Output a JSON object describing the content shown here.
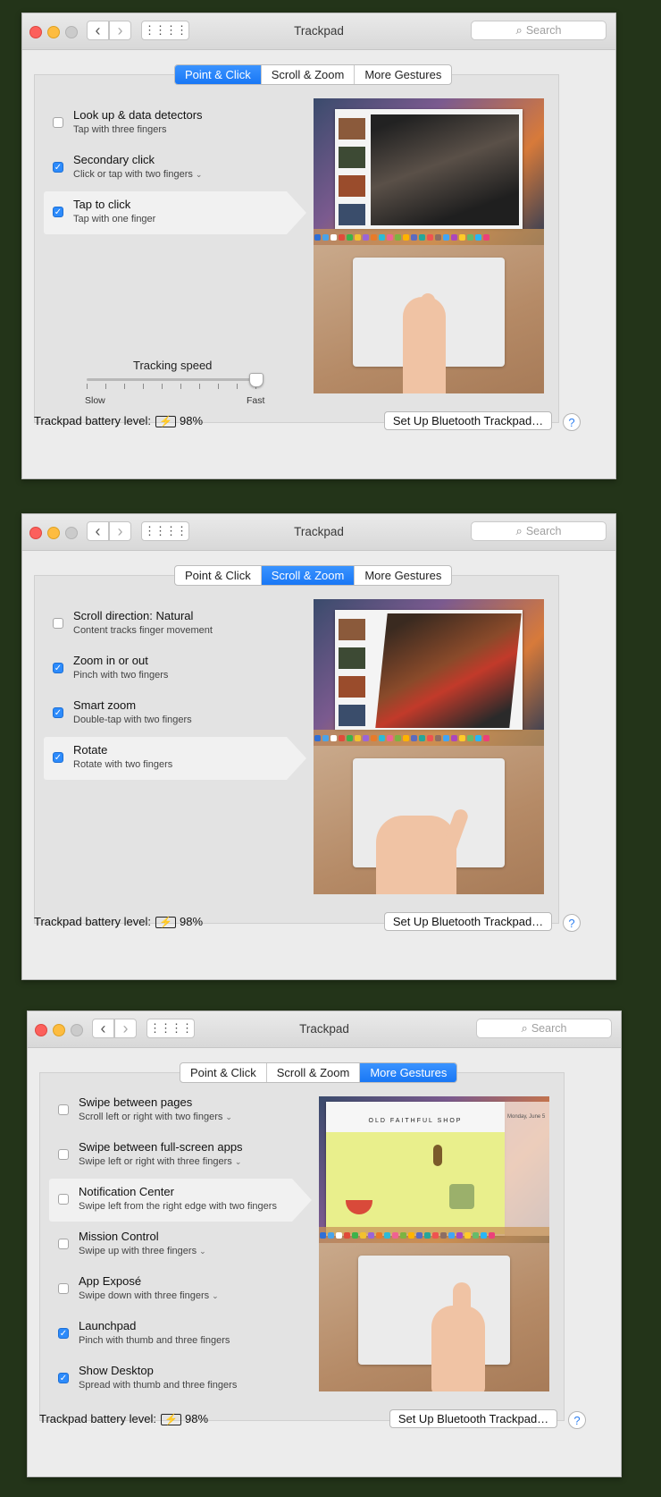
{
  "window_title": "Trackpad",
  "search_placeholder": "Search",
  "tabs": [
    "Point & Click",
    "Scroll & Zoom",
    "More Gestures"
  ],
  "footer": {
    "battery_label": "Trackpad battery level:",
    "battery_value": "98%",
    "setup_button": "Set Up Bluetooth Trackpad…",
    "help": "?"
  },
  "panels": [
    {
      "active_tab": "Point & Click",
      "options": [
        {
          "title": "Look up & data detectors",
          "subtitle": "Tap with three fingers",
          "checked": false,
          "selected": false,
          "has_menu": false
        },
        {
          "title": "Secondary click",
          "subtitle": "Click or tap with two fingers",
          "checked": true,
          "selected": false,
          "has_menu": true
        },
        {
          "title": "Tap to click",
          "subtitle": "Tap with one finger",
          "checked": true,
          "selected": true,
          "has_menu": false
        }
      ],
      "slider": {
        "label": "Tracking speed",
        "min_label": "Slow",
        "max_label": "Fast",
        "value_fraction": 0.97
      }
    },
    {
      "active_tab": "Scroll & Zoom",
      "options": [
        {
          "title": "Scroll direction: Natural",
          "subtitle": "Content tracks finger movement",
          "checked": false,
          "selected": false,
          "has_menu": false
        },
        {
          "title": "Zoom in or out",
          "subtitle": "Pinch with two fingers",
          "checked": true,
          "selected": false,
          "has_menu": false
        },
        {
          "title": "Smart zoom",
          "subtitle": "Double-tap with two fingers",
          "checked": true,
          "selected": false,
          "has_menu": false
        },
        {
          "title": "Rotate",
          "subtitle": "Rotate with two fingers",
          "checked": true,
          "selected": true,
          "has_menu": false
        }
      ]
    },
    {
      "active_tab": "More Gestures",
      "options": [
        {
          "title": "Swipe between pages",
          "subtitle": "Scroll left or right with two fingers",
          "checked": false,
          "selected": false,
          "has_menu": true
        },
        {
          "title": "Swipe between full-screen apps",
          "subtitle": "Swipe left or right with three fingers",
          "checked": false,
          "selected": false,
          "has_menu": true
        },
        {
          "title": "Notification Center",
          "subtitle": "Swipe left from the right edge with two fingers",
          "checked": false,
          "selected": true,
          "has_menu": false
        },
        {
          "title": "Mission Control",
          "subtitle": "Swipe up with three fingers",
          "checked": false,
          "selected": false,
          "has_menu": true
        },
        {
          "title": "App Exposé",
          "subtitle": "Swipe down with three fingers",
          "checked": false,
          "selected": false,
          "has_menu": true
        },
        {
          "title": "Launchpad",
          "subtitle": "Pinch with thumb and three fingers",
          "checked": true,
          "selected": false,
          "has_menu": false
        },
        {
          "title": "Show Desktop",
          "subtitle": "Spread with thumb and three fingers",
          "checked": true,
          "selected": false,
          "has_menu": false
        }
      ],
      "preview_text": {
        "shop_name": "OLD FAITHFUL SHOP",
        "day": "Monday, June 5"
      }
    }
  ]
}
